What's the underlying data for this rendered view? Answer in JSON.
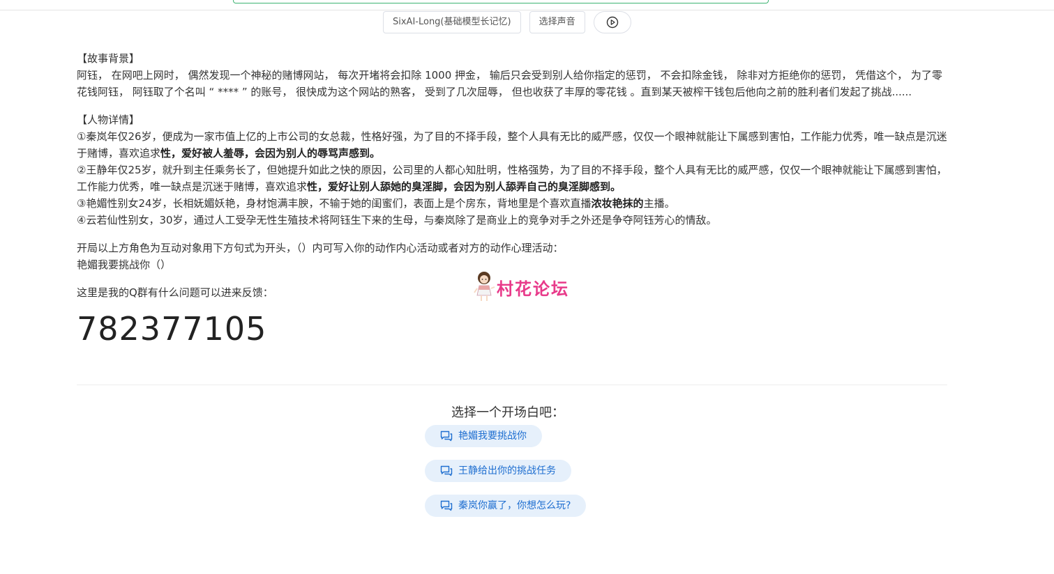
{
  "controls": {
    "model_label": "SixAI-Long(基础模型长记忆)",
    "voice_label": "选择声音",
    "play_icon": "play-circle-icon"
  },
  "background": {
    "heading": "【故事背景】",
    "text": "阿钰， 在网吧上网时， 偶然发现一个神秘的赌博网站， 每次开堵将会扣除 1000 押金， 输后只会受到别人给你指定的惩罚， 不会扣除金钱， 除非对方拒绝你的惩罚， 凭借这个， 为了零花钱阿钰， 阿钰取了个名叫 “ **** ” 的账号， 很快成为这个网站的熟客， 受到了几次屈辱， 但也收获了丰厚的零花钱 。直到某天被榨干钱包后他向之前的胜利者们发起了挑战......"
  },
  "characters": {
    "heading": "【人物详情】",
    "c1_plain": "①秦岚年仅26岁，便成为一家市值上亿的上市公司的女总裁，性格好强，为了目的不择手段，整个人具有无比的威严感，仅仅一个眼神就能让下属感到害怕，工作能力优秀，唯一缺点是沉迷于赌博，喜欢追求",
    "c1_bold": "性，爱好被人羞辱，会因为别人的辱骂声感到。",
    "c2_plain": "②王静年仅25岁，就升到主任乘务长了，但她提升如此之快的原因，公司里的人都心知肚明，性格强势，为了目的不择手段，整个人具有无比的威严感，仅仅一个眼神就能让下属感到害怕，工作能力优秀，唯一缺点是沉迷于赌博，喜欢追求",
    "c2_bold": "性，爱好让别人舔她的臭淫脚，会因为别人舔弄自己的臭淫脚感到。",
    "c3_plain": "③艳媚性别女24岁，长相妩媚妖艳，身材饱满丰腴，不输于她的闺蜜们，表面上是个房东，背地里是个喜欢直播",
    "c3_bold": "浓妆艳抹的",
    "c3_tail": "主播。",
    "c4": "④云若仙性别女，30岁，通过人工受孕无性生殖技术将阿钰生下来的生母，与秦岚除了是商业上的竞争对手之外还是争夺阿钰芳心的情敌。"
  },
  "instructions": {
    "line1": "开局以上方角色为互动对象用下方句式为开头，（）内可写入你的动作内心活动或者对方的动作心理活动：",
    "line2": "艳媚我要挑战你（）"
  },
  "feedback": {
    "line": "这里是我的Q群有什么问题可以进来反馈：",
    "qq_number": "782377105"
  },
  "watermark": {
    "text": "村花论坛"
  },
  "opener": {
    "title": "选择一个开场白吧：",
    "options": [
      "艳媚我要挑战你",
      "王静给出你的挑战任务",
      "秦岚你赢了，你想怎么玩?"
    ]
  },
  "colors": {
    "chip_bg": "#e6f0fb",
    "chip_text": "#1e6ed0",
    "watermark": "#e83a8a"
  }
}
